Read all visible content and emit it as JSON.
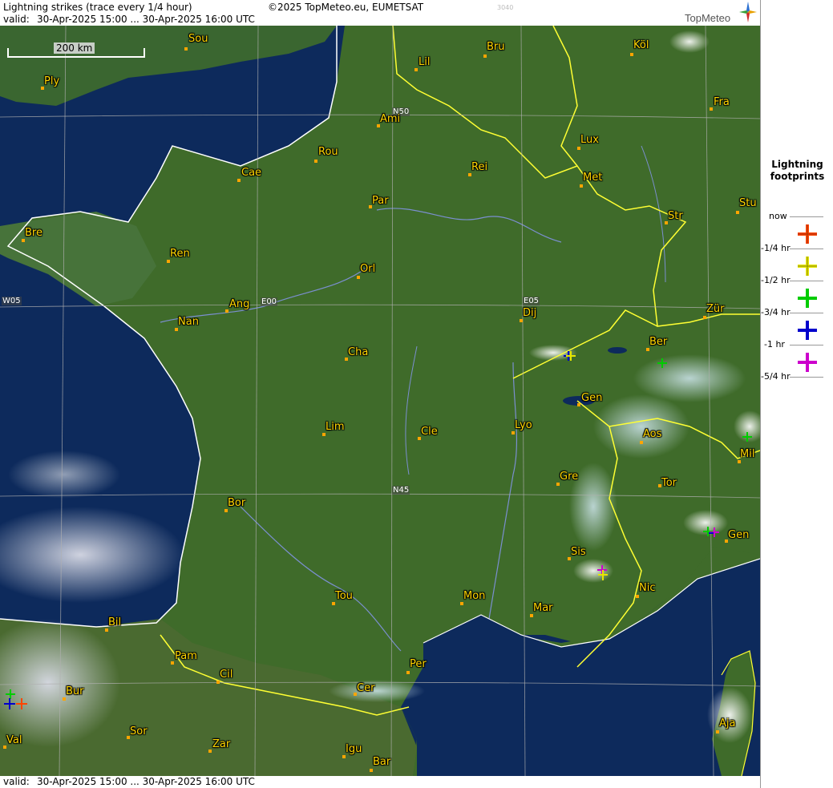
{
  "header": {
    "title": "Lightning strikes (trace every 1/4 hour)",
    "copyright": "©2025 TopMeteo.eu, EUMETSAT",
    "valid_prefix": "valid:",
    "valid_range": "30-Apr-2025 15:00 ... 30-Apr-2025 16:00 UTC",
    "code": "3040"
  },
  "logo": {
    "text": "TopMeteo"
  },
  "footer": {
    "valid_prefix": "valid:",
    "valid_range": "30-Apr-2025 15:00 ... 30-Apr-2025 16:00 UTC"
  },
  "scale_bar": {
    "label": "200 km"
  },
  "grid_labels": {
    "n50": "N50",
    "n45": "N45",
    "w05": "W05",
    "e00": "E00",
    "e05": "E05"
  },
  "cities": [
    "Sou",
    "Ply",
    "Lil",
    "Bru",
    "Köl",
    "Fra",
    "Ami",
    "Lux",
    "Rou",
    "Cae",
    "Rei",
    "Met",
    "Par",
    "Str",
    "Stu",
    "Bre",
    "Ren",
    "Orl",
    "Ang",
    "Zür",
    "Nan",
    "Dij",
    "Ber",
    "Cha",
    "Gen",
    "Lim",
    "Cle",
    "Lyo",
    "Aos",
    "Mil",
    "Gre",
    "Tor",
    "Bor",
    "Gen",
    "Sis",
    "Nic",
    "Tou",
    "Mon",
    "Mar",
    "Bil",
    "Pam",
    "Cil",
    "Per",
    "Cer",
    "Bur",
    "Sor",
    "Zar",
    "Val",
    "Igu",
    "Bar",
    "Aja"
  ],
  "legend": {
    "title_line1": "Lightning",
    "title_line2": "footprints",
    "rows": [
      {
        "label": "now",
        "color": "#ff4500"
      },
      {
        "label": "-1/4 hr",
        "color": "#e6e600"
      },
      {
        "label": "-1/2 hr",
        "color": "#00cc00"
      },
      {
        "label": "-3/4 hr",
        "color": "#0000cc"
      },
      {
        "label": "-1 hr",
        "color": "#cc00cc"
      },
      {
        "label": "-5/4 hr",
        "color": ""
      }
    ]
  },
  "colors": {
    "sea": "#0d2a5c",
    "land": "#3f6b2a",
    "border": "#ffff33",
    "city_text": "#ffd700",
    "city_dot": "#ffa500"
  }
}
